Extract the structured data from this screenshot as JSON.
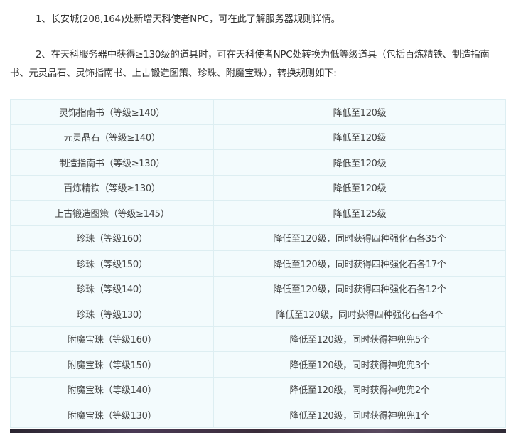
{
  "paragraphs": [
    "1、长安城(208,164)处新增天科使者NPC，可在此了解服务器规则详情。",
    "2、在天科服务器中获得≥130级的道具时，可在天科使者NPC处转换为低等级道具（包括百炼精铁、制造指南书、元灵晶石、灵饰指南书、上古锻造图策、珍珠、附魔宝珠），转换规则如下:"
  ],
  "table": {
    "rows": [
      {
        "item": "灵饰指南书（等级≥140）",
        "rule": "降低至120级"
      },
      {
        "item": "元灵晶石（等级≥140）",
        "rule": "降低至120级"
      },
      {
        "item": "制造指南书（等级≥130）",
        "rule": "降低至120级"
      },
      {
        "item": "百炼精铁（等级≥130）",
        "rule": "降低至120级"
      },
      {
        "item": "上古锻造图策（等级≥145）",
        "rule": "降低至125级"
      },
      {
        "item": "珍珠（等级160）",
        "rule": "降低至120级，同时获得四种强化石各35个"
      },
      {
        "item": "珍珠（等级150）",
        "rule": "降低至120级，同时获得四种强化石各17个"
      },
      {
        "item": "珍珠（等级140）",
        "rule": "降低至120级，同时获得四种强化石各12个"
      },
      {
        "item": "珍珠（等级130）",
        "rule": "降低至120级，同时获得四种强化石各4个"
      },
      {
        "item": "附魔宝珠（等级160）",
        "rule": "降低至120级，同时获得神兜兜5个"
      },
      {
        "item": "附魔宝珠（等级150）",
        "rule": "降低至120级，同时获得神兜兜3个"
      },
      {
        "item": "附魔宝珠（等级140）",
        "rule": "降低至120级，同时获得神兜兜2个"
      },
      {
        "item": "附魔宝珠（等级130）",
        "rule": "降低至120级，同时获得神兜兜1个"
      }
    ]
  }
}
